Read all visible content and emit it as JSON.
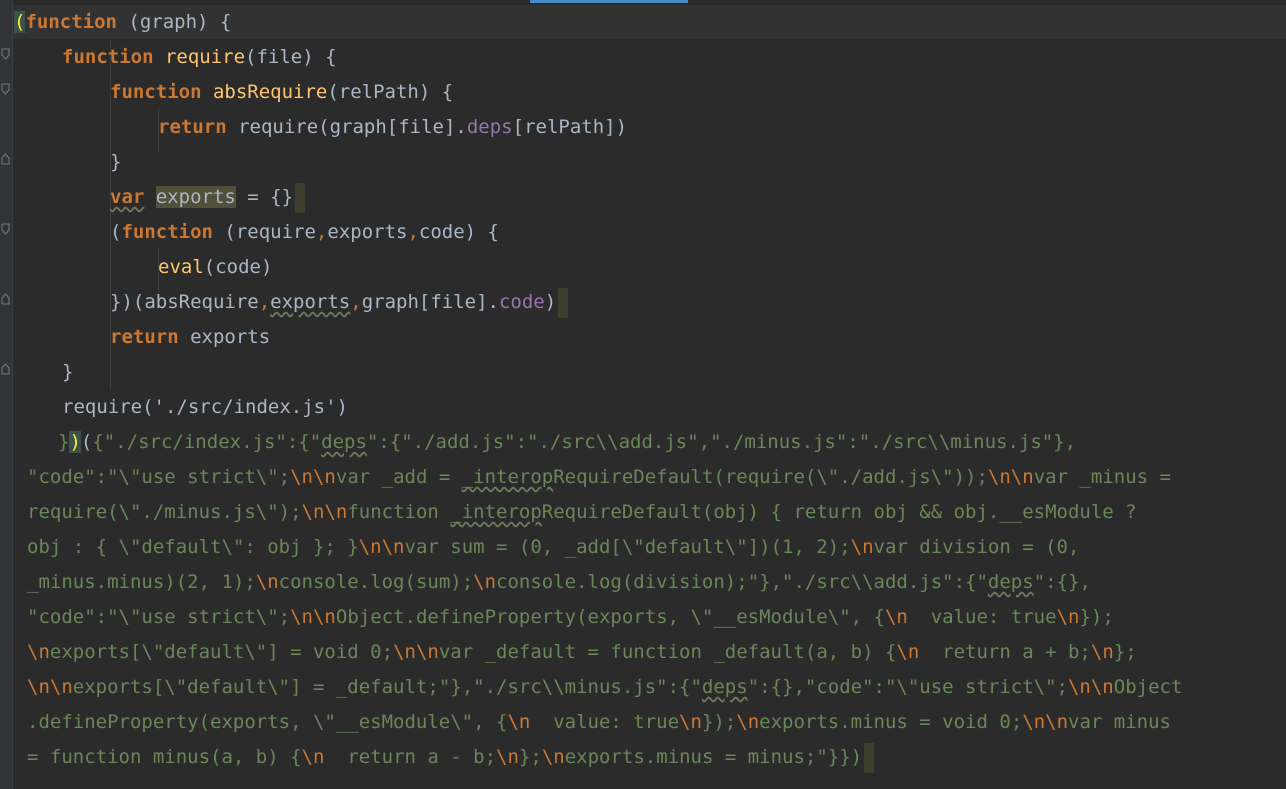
{
  "editor": {
    "lines": [
      {
        "indent": 0,
        "tokens": [
          {
            "t": "(",
            "c": "brace-hl"
          },
          {
            "t": "function",
            "c": "k"
          },
          {
            "t": " (graph) {"
          }
        ]
      },
      {
        "indent": 1,
        "tokens": [
          {
            "t": "function",
            "c": "k"
          },
          {
            "t": " "
          },
          {
            "t": "require",
            "c": "f"
          },
          {
            "t": "(file) {"
          }
        ]
      },
      {
        "indent": 2,
        "tokens": [
          {
            "t": "function",
            "c": "k"
          },
          {
            "t": " "
          },
          {
            "t": "absRequire",
            "c": "f"
          },
          {
            "t": "(relPath) {"
          }
        ]
      },
      {
        "indent": 3,
        "tokens": [
          {
            "t": "return",
            "c": "k"
          },
          {
            "t": " require(graph[file]."
          },
          {
            "t": "deps",
            "c": "p"
          },
          {
            "t": "[relPath])"
          }
        ]
      },
      {
        "indent": 2,
        "tokens": [
          {
            "t": "}"
          }
        ]
      },
      {
        "indent": 2,
        "caret": true,
        "tokens": [
          {
            "t": "var",
            "c": "k w"
          },
          {
            "t": " "
          },
          {
            "t": "exports",
            "c": "hl"
          },
          {
            "t": " = {}"
          }
        ]
      },
      {
        "indent": 2,
        "tokens": [
          {
            "t": "("
          },
          {
            "t": "function",
            "c": "k"
          },
          {
            "t": " (require"
          },
          {
            "t": ",",
            "c": "c"
          },
          {
            "t": "exports"
          },
          {
            "t": ",",
            "c": "c"
          },
          {
            "t": "code) {"
          }
        ]
      },
      {
        "indent": 3,
        "tokens": [
          {
            "t": "eval",
            "c": "f"
          },
          {
            "t": "(code)"
          }
        ]
      },
      {
        "indent": 2,
        "caret": true,
        "tokens": [
          {
            "t": "})(absRequire"
          },
          {
            "t": ",",
            "c": "c"
          },
          {
            "t": "exports",
            "c": "w"
          },
          {
            "t": ",",
            "c": "c"
          },
          {
            "t": "graph[file]."
          },
          {
            "t": "code",
            "c": "p"
          },
          {
            "t": ")"
          }
        ]
      },
      {
        "indent": 2,
        "tokens": [
          {
            "t": "return",
            "c": "k"
          },
          {
            "t": " exports"
          }
        ]
      },
      {
        "indent": 1,
        "tokens": [
          {
            "t": "}"
          }
        ]
      },
      {
        "indent": 1,
        "tokens": [
          {
            "t": "require('./src/index.js')"
          }
        ]
      },
      {
        "indent": 0,
        "x": 58,
        "tokens": [
          {
            "t": "}",
            "c": "s"
          },
          {
            "t": ")",
            "c": "brace-hl"
          },
          {
            "t": "("
          },
          {
            "t": "{\"./src/index.js\":{\"",
            "c": "s"
          },
          {
            "t": "deps",
            "c": "s w"
          },
          {
            "t": "\":{\"./add.js\":\"./src\\\\add.js\",\"./minus.js\":\"./src\\\\minus.js\"},",
            "c": "s"
          }
        ]
      },
      {
        "indent": 0,
        "x": 27,
        "tokens": [
          {
            "t": "\"code\":\"\\\"use strict\\\";",
            "c": "s"
          },
          {
            "t": "\\n\\n",
            "c": "e"
          },
          {
            "t": "var _add = ",
            "c": "s"
          },
          {
            "t": "_interop",
            "c": "s w"
          },
          {
            "t": "RequireDefault(require(\\\"./add.js\\\"));",
            "c": "s"
          },
          {
            "t": "\\n\\n",
            "c": "e"
          },
          {
            "t": "var _minus =",
            "c": "s"
          }
        ]
      },
      {
        "indent": 0,
        "x": 27,
        "tokens": [
          {
            "t": "require(\\\"./minus.js\\\");",
            "c": "s"
          },
          {
            "t": "\\n\\n",
            "c": "e"
          },
          {
            "t": "function ",
            "c": "s"
          },
          {
            "t": "_interop",
            "c": "s w"
          },
          {
            "t": "RequireDefault(obj) { return obj && obj.__esModule ?",
            "c": "s"
          }
        ]
      },
      {
        "indent": 0,
        "x": 27,
        "tokens": [
          {
            "t": "obj : { \\\"default\\\": obj }; }",
            "c": "s"
          },
          {
            "t": "\\n\\n",
            "c": "e"
          },
          {
            "t": "var sum = (0, _add[\\\"default\\\"])(1, 2);",
            "c": "s"
          },
          {
            "t": "\\n",
            "c": "e"
          },
          {
            "t": "var division = (0,",
            "c": "s"
          }
        ]
      },
      {
        "indent": 0,
        "x": 27,
        "tokens": [
          {
            "t": "_minus.minus)(2, 1);",
            "c": "s"
          },
          {
            "t": "\\n",
            "c": "e"
          },
          {
            "t": "console.log(sum);",
            "c": "s"
          },
          {
            "t": "\\n",
            "c": "e"
          },
          {
            "t": "console.log(division);\"},\"./src\\\\add.js\":{\"",
            "c": "s"
          },
          {
            "t": "deps",
            "c": "s w"
          },
          {
            "t": "\":{},",
            "c": "s"
          }
        ]
      },
      {
        "indent": 0,
        "x": 27,
        "tokens": [
          {
            "t": "\"code\":\"\\\"use strict\\\";",
            "c": "s"
          },
          {
            "t": "\\n\\n",
            "c": "e"
          },
          {
            "t": "Object.defineProperty(exports, \\\"__esModule\\\", {",
            "c": "s"
          },
          {
            "t": "\\n",
            "c": "e"
          },
          {
            "t": "  value: true",
            "c": "s"
          },
          {
            "t": "\\n",
            "c": "e"
          },
          {
            "t": "});",
            "c": "s"
          }
        ]
      },
      {
        "indent": 0,
        "x": 27,
        "tokens": [
          {
            "t": "\\n",
            "c": "e"
          },
          {
            "t": "exports[\\\"default\\\"] = void 0;",
            "c": "s"
          },
          {
            "t": "\\n\\n",
            "c": "e"
          },
          {
            "t": "var _default = function _default(a, b) {",
            "c": "s"
          },
          {
            "t": "\\n",
            "c": "e"
          },
          {
            "t": "  return a + b;",
            "c": "s"
          },
          {
            "t": "\\n",
            "c": "e"
          },
          {
            "t": "};",
            "c": "s"
          }
        ]
      },
      {
        "indent": 0,
        "x": 27,
        "tokens": [
          {
            "t": "\\n\\n",
            "c": "e"
          },
          {
            "t": "exports[\\\"default\\\"] = _default;\"},\"./src\\\\minus.js\":{\"",
            "c": "s"
          },
          {
            "t": "deps",
            "c": "s w"
          },
          {
            "t": "\":{},\"code\":\"\\\"use strict\\\";",
            "c": "s"
          },
          {
            "t": "\\n\\n",
            "c": "e"
          },
          {
            "t": "Object",
            "c": "s"
          }
        ]
      },
      {
        "indent": 0,
        "x": 27,
        "tokens": [
          {
            "t": ".defineProperty(exports, \\\"__esModule\\\", {",
            "c": "s"
          },
          {
            "t": "\\n",
            "c": "e"
          },
          {
            "t": "  value: true",
            "c": "s"
          },
          {
            "t": "\\n",
            "c": "e"
          },
          {
            "t": "});",
            "c": "s"
          },
          {
            "t": "\\n",
            "c": "e"
          },
          {
            "t": "exports.minus = void 0;",
            "c": "s"
          },
          {
            "t": "\\n\\n",
            "c": "e"
          },
          {
            "t": "var minus",
            "c": "s"
          }
        ]
      },
      {
        "indent": 0,
        "x": 27,
        "caret": true,
        "tokens": [
          {
            "t": "= function minus(a, b) {",
            "c": "s"
          },
          {
            "t": "\\n",
            "c": "e"
          },
          {
            "t": "  return a - b;",
            "c": "s"
          },
          {
            "t": "\\n",
            "c": "e"
          },
          {
            "t": "};",
            "c": "s"
          },
          {
            "t": "\\n",
            "c": "e"
          },
          {
            "t": "exports.minus = minus;\"}})",
            "c": "s"
          }
        ]
      }
    ]
  }
}
